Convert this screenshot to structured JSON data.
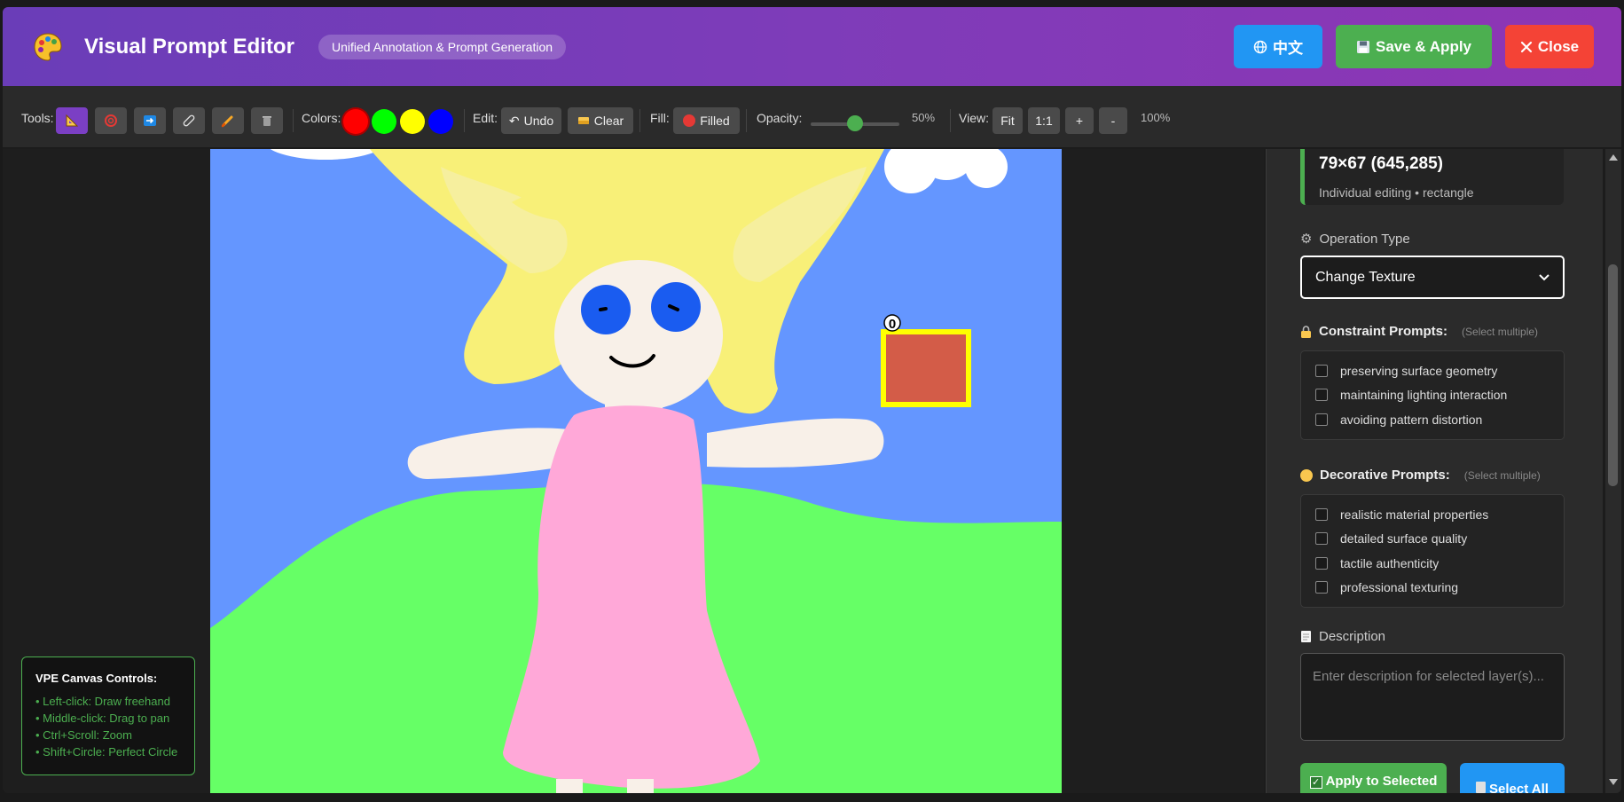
{
  "header": {
    "title": "Visual Prompt Editor",
    "subtitle": "Unified Annotation & Prompt Generation",
    "lang_button": "中文",
    "save_button": "Save & Apply",
    "close_button": "Close"
  },
  "toolbar": {
    "tools_label": "Tools:",
    "colors_label": "Colors:",
    "edit_label": "Edit:",
    "undo_label": "Undo",
    "clear_label": "Clear",
    "fill_label": "Fill:",
    "filled_label": "Filled",
    "opacity_label": "Opacity:",
    "opacity_value": "50%",
    "opacity_level": 0.5,
    "view_label": "View:",
    "fit_label": "Fit",
    "one_to_one_label": "1:1",
    "zoom_in_label": "+",
    "zoom_out_label": "-",
    "zoom_value": "100%",
    "colors": [
      "#ff0000",
      "#00ff00",
      "#ffff00",
      "#0000ff"
    ]
  },
  "canvas": {
    "annotation_number": "0",
    "controls_title": "VPE Canvas Controls:",
    "controls": [
      "• Left-click: Draw freehand",
      "• Middle-click: Drag to pan",
      "• Ctrl+Scroll: Zoom",
      "• Shift+Circle: Perfect Circle"
    ]
  },
  "panel": {
    "layer_size": "79×67 (645,285)",
    "layer_desc": "Individual editing • rectangle",
    "operation_label": "Operation Type",
    "operation_value": "Change Texture",
    "constraint_label": "Constraint Prompts:",
    "constraint_hint": "(Select multiple)",
    "constraints": [
      "preserving surface geometry",
      "maintaining lighting interaction",
      "avoiding pattern distortion"
    ],
    "decorative_label": "Decorative Prompts:",
    "decorative_hint": "(Select multiple)",
    "decoratives": [
      "realistic material properties",
      "detailed surface quality",
      "tactile authenticity",
      "professional texturing"
    ],
    "description_label": "Description",
    "description_placeholder": "Enter description for selected layer(s)...",
    "apply_button": "Apply to Selected",
    "select_all_button": "Select All"
  }
}
